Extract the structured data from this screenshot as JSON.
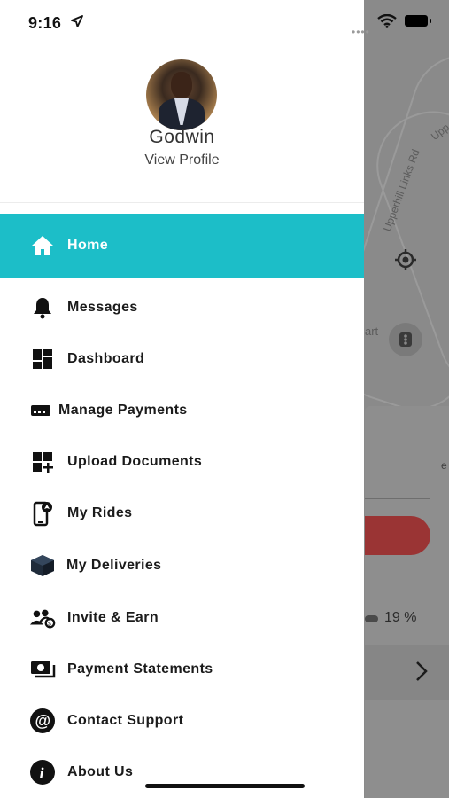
{
  "status_bar": {
    "time": "9:16"
  },
  "profile": {
    "name": "Godwin",
    "view_profile": "View Profile"
  },
  "menu": {
    "items": [
      {
        "label": "Home",
        "icon": "home-icon",
        "active": true
      },
      {
        "label": "Messages",
        "icon": "bell-icon"
      },
      {
        "label": "Dashboard",
        "icon": "dashboard-icon"
      },
      {
        "label": "Manage Payments",
        "icon": "payment-card-icon"
      },
      {
        "label": "Upload Documents",
        "icon": "upload-documents-icon"
      },
      {
        "label": "My Rides",
        "icon": "rides-phone-icon"
      },
      {
        "label": "My Deliveries",
        "icon": "delivery-box-icon"
      },
      {
        "label": "Invite & Earn",
        "icon": "invite-users-icon"
      },
      {
        "label": "Payment Statements",
        "icon": "statement-cash-icon"
      },
      {
        "label": "Contact Support",
        "icon": "at-sign-icon"
      },
      {
        "label": "About Us",
        "icon": "info-icon"
      }
    ]
  },
  "background": {
    "road_label_1": "Upperhill Links Rd",
    "road_label_2": "Upp",
    "map_text": "art",
    "side_text": "e",
    "battery_percent": "19 %"
  },
  "colors": {
    "accent": "#1cbec8",
    "text": "#1b1b1b",
    "go_button": "#9a3434"
  }
}
